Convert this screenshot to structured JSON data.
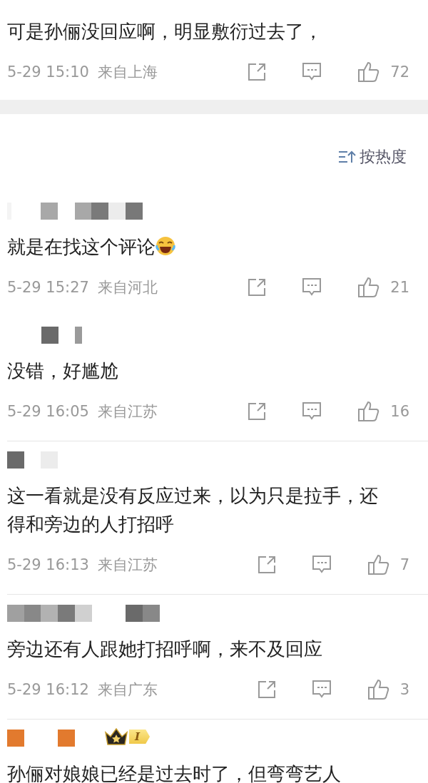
{
  "comments": [
    {
      "text": "可是孙俪没回应啊，明显敷衍过去了，",
      "trailing_emoji": false,
      "time": "5-29 15:10",
      "location": "来自上海",
      "likes": "72"
    },
    {
      "text": "就是在找这个评论",
      "trailing_emoji": true,
      "time": "5-29 15:27",
      "location": "来自河北",
      "likes": "21"
    },
    {
      "text": "没错，好尴尬",
      "trailing_emoji": false,
      "time": "5-29 16:05",
      "location": "来自江苏",
      "likes": "16"
    },
    {
      "text": "这一看就是没有反应过来，以为只是拉手，还得和旁边的人打招呼",
      "trailing_emoji": false,
      "time": "5-29 16:13",
      "location": "来自江苏",
      "likes": "7"
    },
    {
      "text": "旁边还有人跟她打招呼啊，来不及回应",
      "trailing_emoji": false,
      "time": "5-29 16:12",
      "location": "来自广东",
      "likes": "3"
    },
    {
      "text": "孙俪对娘娘已经是过去时了，但弯弯艺人",
      "trailing_emoji": false,
      "badge": {
        "level": "I"
      }
    }
  ],
  "sort": {
    "label": "按热度"
  }
}
